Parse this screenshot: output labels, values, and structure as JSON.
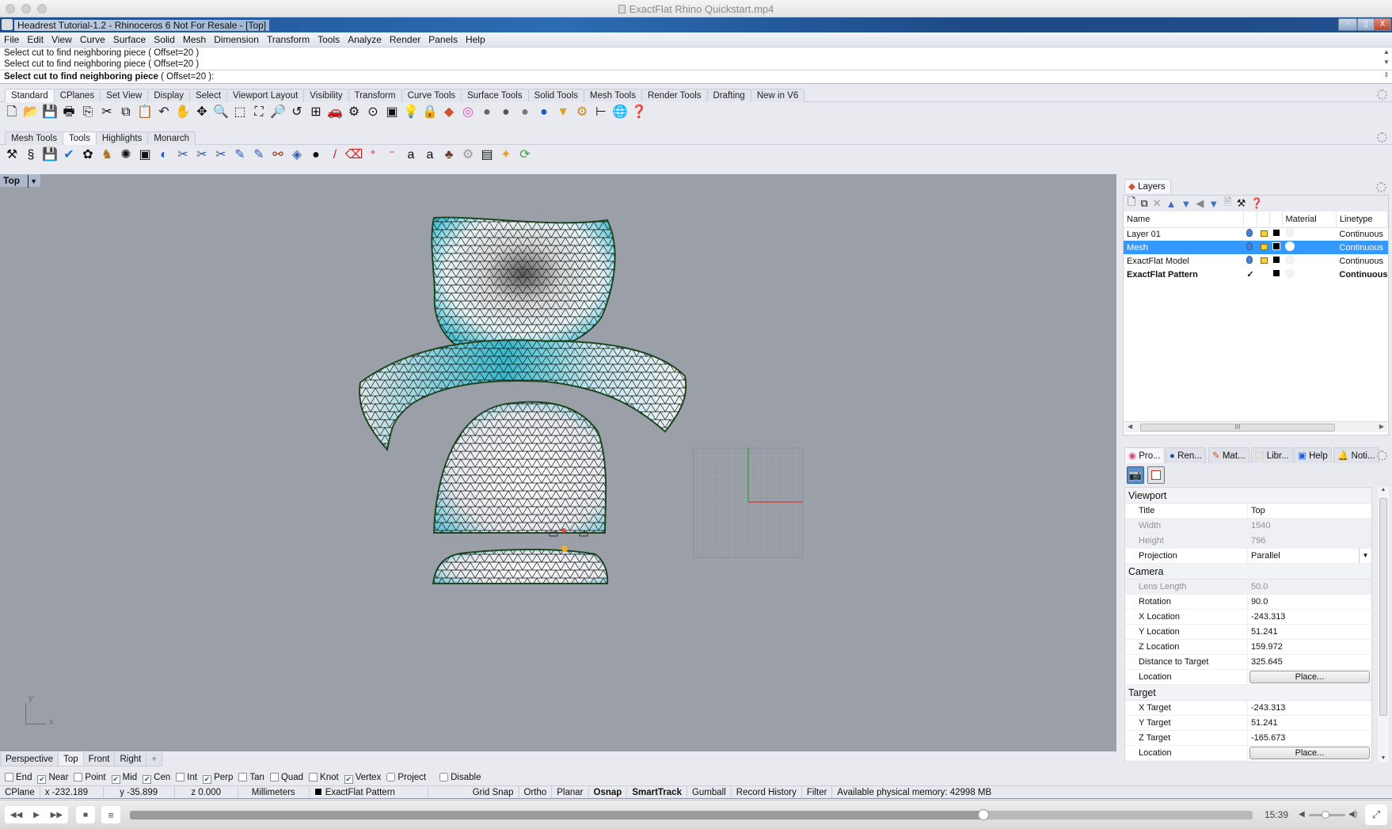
{
  "mac_window": {
    "title": "ExactFlat Rhino Quickstart.mp4"
  },
  "app": {
    "title": "Headrest Tutorial-1.2 - Rhinoceros 6 Not For Resale - [Top]",
    "window_buttons": {
      "minimize": "-",
      "restore": "▯",
      "close": "X"
    }
  },
  "menu": [
    "File",
    "Edit",
    "View",
    "Curve",
    "Surface",
    "Solid",
    "Mesh",
    "Dimension",
    "Transform",
    "Tools",
    "Analyze",
    "Render",
    "Panels",
    "Help"
  ],
  "command": {
    "history": [
      "Select cut to find neighboring piece ( Offset=20 )",
      "Select cut to find neighboring piece ( Offset=20 )"
    ],
    "prompt": "Select cut to find neighboring piece",
    "prompt_options": "( Offset=20 ):"
  },
  "toolbar_tabs_1": {
    "tabs": [
      "Standard",
      "CPlanes",
      "Set View",
      "Display",
      "Select",
      "Viewport Layout",
      "Visibility",
      "Transform",
      "Curve Tools",
      "Surface Tools",
      "Solid Tools",
      "Mesh Tools",
      "Render Tools",
      "Drafting",
      "New in V6"
    ],
    "active": "Standard",
    "icons": [
      "new-file",
      "open-folder",
      "save",
      "print",
      "import",
      "cut",
      "copy",
      "paste",
      "undo",
      "pan-hand",
      "rotate-view",
      "zoom-in",
      "zoom-window",
      "zoom-extents",
      "zoom-selected",
      "undo-view",
      "four-viewports",
      "car-shade",
      "properties",
      "cplane",
      "layers-bulb",
      "lightbulb",
      "lock",
      "layer-color",
      "color-wheel",
      "material-ball",
      "shaded-ball",
      "rendered-ball",
      "blue-ball",
      "spotlight",
      "options-gear",
      "dimension",
      "rhino-globe",
      "help"
    ]
  },
  "toolbar_tabs_2": {
    "tabs": [
      "Mesh Tools",
      "Tools",
      "Highlights",
      "Monarch"
    ],
    "active": "Tools",
    "icons": [
      "flatten-mesh",
      "spiral",
      "save-pattern",
      "checkmark",
      "outline",
      "leather-hide",
      "mesh-web",
      "select-pieces",
      "sphere-edit",
      "cut-tool",
      "cut-c",
      "cut-p",
      "paint-edit",
      "paint-edit-2",
      "binoculars",
      "blue-cube",
      "grenade",
      "pencil",
      "eraser",
      "add-notch",
      "remove-notch",
      "text-a",
      "text-a-2",
      "puzzle",
      "settings",
      "report",
      "wand",
      "refresh"
    ]
  },
  "viewport": {
    "name": "Top",
    "axis_labels": {
      "x": "x",
      "y": "y"
    },
    "tabs": [
      "Perspective",
      "Top",
      "Front",
      "Right"
    ],
    "active_tab": "Top",
    "add_tab": "+"
  },
  "osnap": [
    {
      "label": "End",
      "checked": false
    },
    {
      "label": "Near",
      "checked": true
    },
    {
      "label": "Point",
      "checked": false
    },
    {
      "label": "Mid",
      "checked": true
    },
    {
      "label": "Cen",
      "checked": true
    },
    {
      "label": "Int",
      "checked": false
    },
    {
      "label": "Perp",
      "checked": true
    },
    {
      "label": "Tan",
      "checked": false
    },
    {
      "label": "Quad",
      "checked": false
    },
    {
      "label": "Knot",
      "checked": false
    },
    {
      "label": "Vertex",
      "checked": true
    },
    {
      "label": "Project",
      "checked": false
    },
    {
      "label": "Disable",
      "checked": false
    }
  ],
  "status": {
    "cplane": "CPlane",
    "x": "x -232.189",
    "y": "y -35.899",
    "z": "z 0.000",
    "units": "Millimeters",
    "layer": "ExactFlat Pattern",
    "toggles": [
      {
        "label": "Grid Snap",
        "on": false
      },
      {
        "label": "Ortho",
        "on": false
      },
      {
        "label": "Planar",
        "on": false
      },
      {
        "label": "Osnap",
        "on": true
      },
      {
        "label": "SmartTrack",
        "on": true
      },
      {
        "label": "Gumball",
        "on": false
      },
      {
        "label": "Record History",
        "on": false
      },
      {
        "label": "Filter",
        "on": false
      }
    ],
    "memory": "Available physical memory: 42998 MB"
  },
  "layers": {
    "tab": "Layers",
    "columns": [
      "Name",
      "Material",
      "Linetype"
    ],
    "rows": [
      {
        "name": "Layer 01",
        "linetype": "Continuous",
        "current": false,
        "selected": false,
        "visible": true,
        "locked": false
      },
      {
        "name": "Mesh",
        "linetype": "Continuous",
        "current": false,
        "selected": true,
        "visible": true,
        "locked": false
      },
      {
        "name": "ExactFlat Model",
        "linetype": "Continuous",
        "current": false,
        "selected": false,
        "visible": true,
        "locked": false
      },
      {
        "name": "ExactFlat Pattern",
        "linetype": "Continuous",
        "current": true,
        "selected": false,
        "visible": true,
        "locked": false
      }
    ],
    "current_mark": "✓",
    "scroll_thumb": "III"
  },
  "properties": {
    "tabs": [
      "Pro...",
      "Ren...",
      "Mat...",
      "Libr...",
      "Help",
      "Noti..."
    ],
    "active_tab": "Pro...",
    "sections": [
      {
        "title": "Viewport",
        "rows": [
          {
            "key": "Title",
            "value": "Top",
            "disabled": false
          },
          {
            "key": "Width",
            "value": "1540",
            "disabled": true
          },
          {
            "key": "Height",
            "value": "796",
            "disabled": true
          },
          {
            "key": "Projection",
            "value": "Parallel",
            "disabled": false,
            "dropdown": true
          }
        ]
      },
      {
        "title": "Camera",
        "rows": [
          {
            "key": "Lens Length",
            "value": "50.0",
            "disabled": true
          },
          {
            "key": "Rotation",
            "value": "90.0",
            "disabled": false
          },
          {
            "key": "X Location",
            "value": "-243.313",
            "disabled": false
          },
          {
            "key": "Y Location",
            "value": "51.241",
            "disabled": false
          },
          {
            "key": "Z Location",
            "value": "159.972",
            "disabled": false
          },
          {
            "key": "Distance to Target",
            "value": "325.645",
            "disabled": false
          },
          {
            "key": "Location",
            "value": "Place...",
            "button": true
          }
        ]
      },
      {
        "title": "Target",
        "rows": [
          {
            "key": "X Target",
            "value": "-243.313",
            "disabled": false
          },
          {
            "key": "Y Target",
            "value": "51.241",
            "disabled": false
          },
          {
            "key": "Z Target",
            "value": "-165.673",
            "disabled": false
          },
          {
            "key": "Location",
            "value": "Place...",
            "button": true
          }
        ]
      }
    ]
  },
  "video": {
    "time": "15:39",
    "progress": 0.76,
    "volume": 0.45,
    "buttons": [
      "rewind",
      "play",
      "fast-forward",
      "stop",
      "playlist",
      "fullscreen"
    ]
  }
}
